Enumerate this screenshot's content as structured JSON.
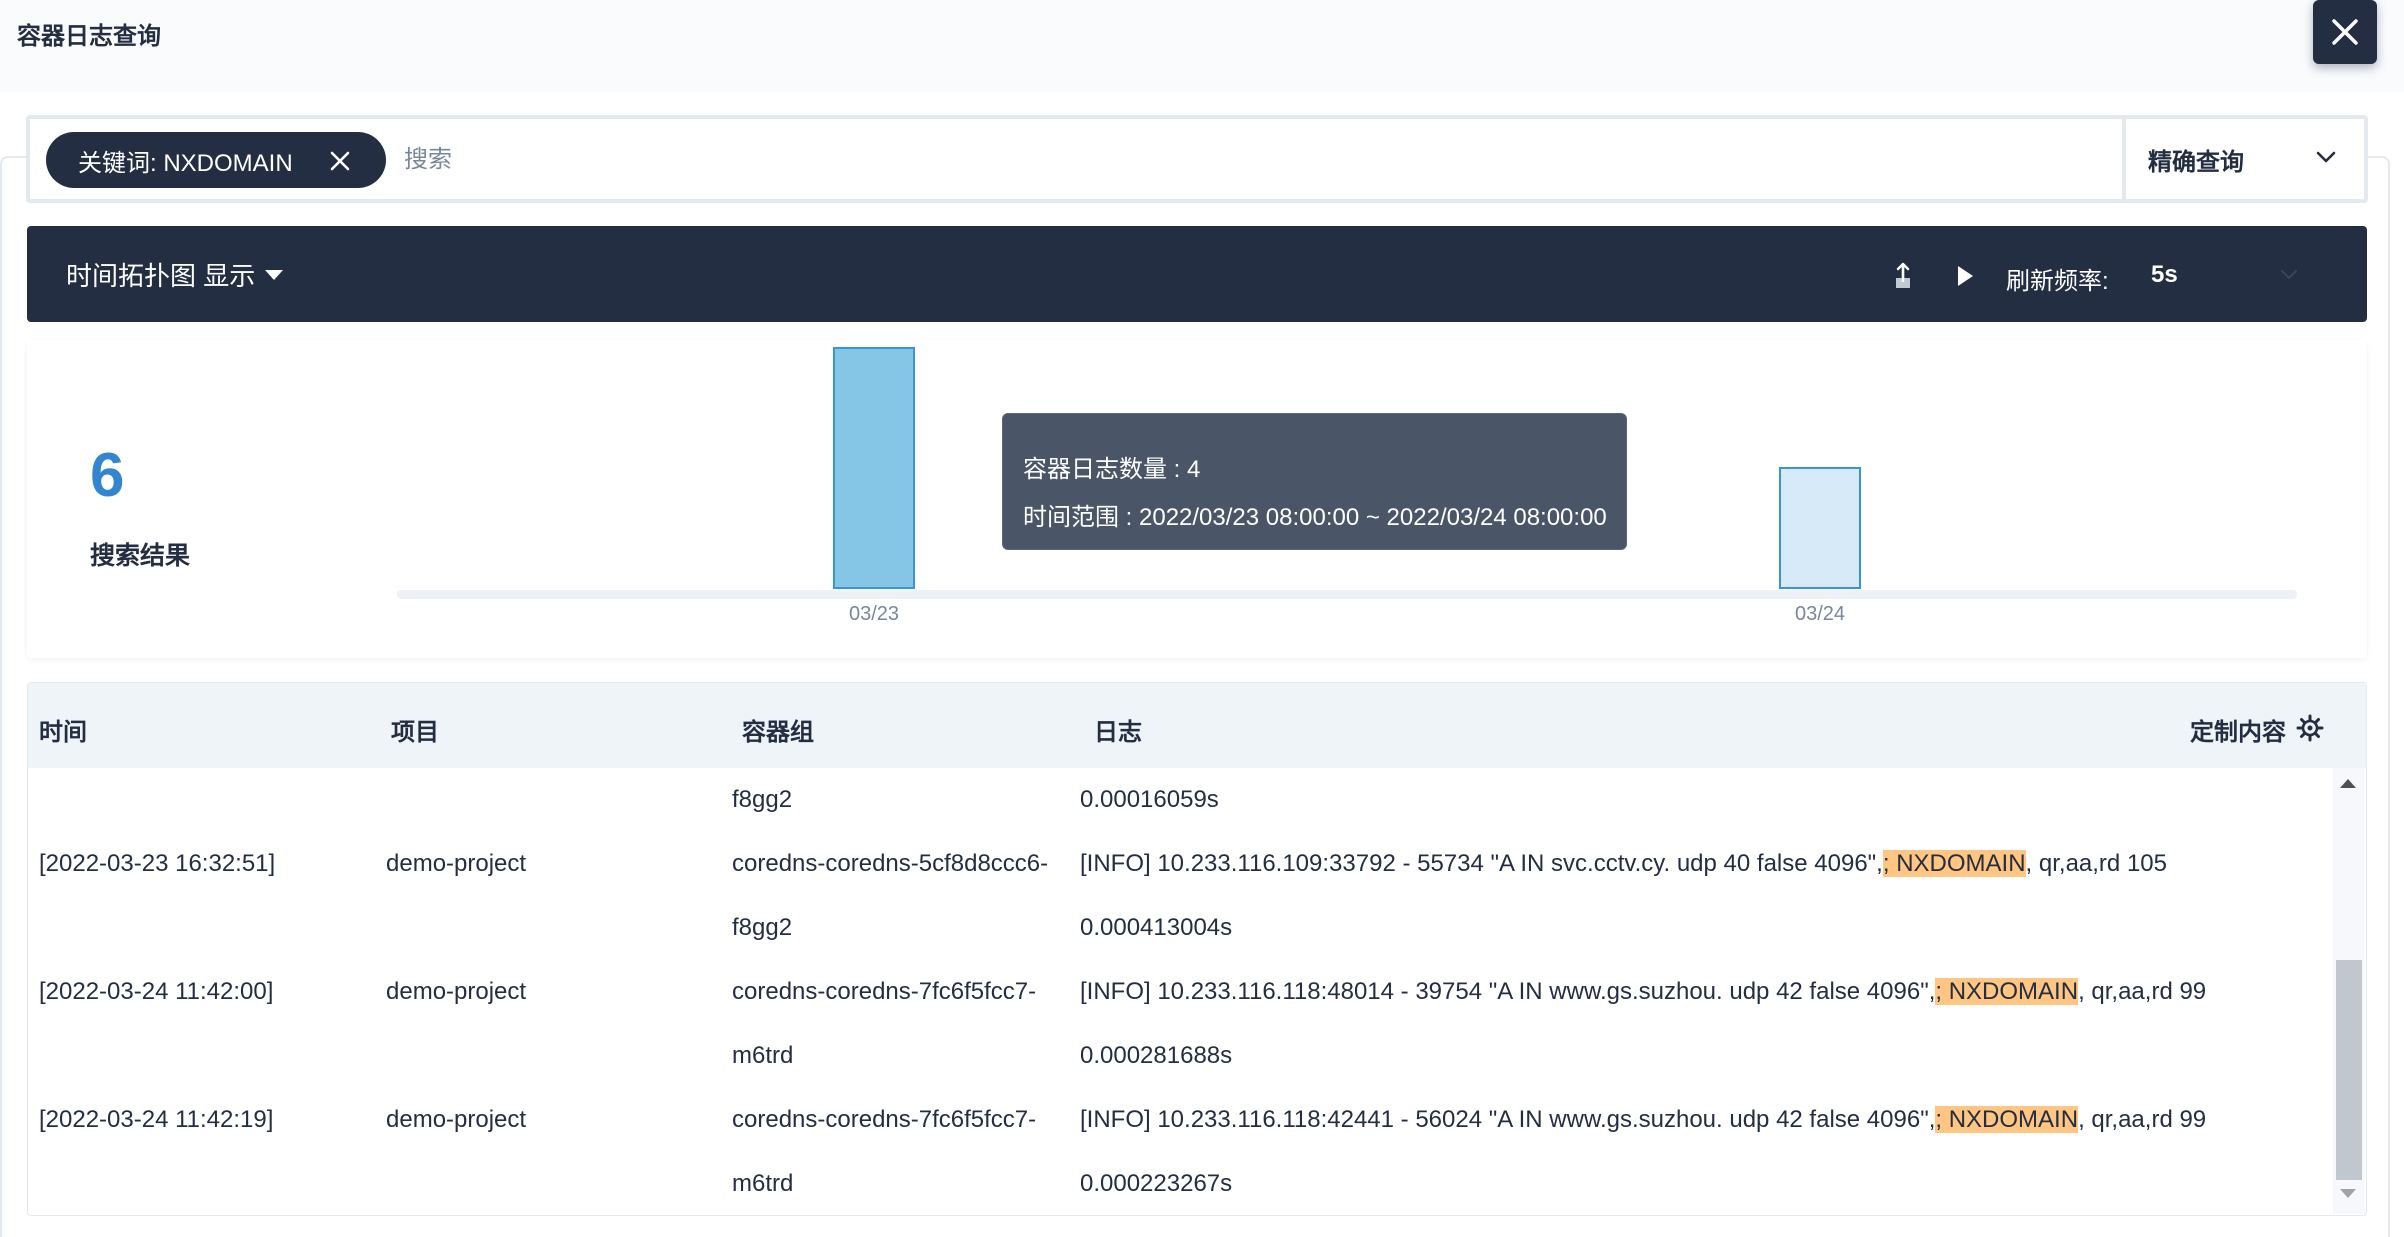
{
  "dialog": {
    "title": "容器日志查询",
    "close_icon": "close-icon"
  },
  "search": {
    "tag_label": "关键词: NXDOMAIN",
    "placeholder": "搜索",
    "mode": "精确查询"
  },
  "toolbar": {
    "toggle_label": "时间拓扑图 显示",
    "refresh_label": "刷新频率:",
    "refresh_value": "5s"
  },
  "summary": {
    "count": "6",
    "label": "搜索结果"
  },
  "chart_data": {
    "type": "bar",
    "categories": [
      "03/23",
      "03/24"
    ],
    "values": [
      4,
      2
    ],
    "title": "",
    "xlabel": "",
    "ylabel": "",
    "colors": [
      "#85c5e5",
      "#d6eaf7"
    ],
    "border_color": "#3a95d5"
  },
  "tooltip": {
    "line1": "容器日志数量 : 4",
    "line2": "时间范围 : 2022/03/23 08:00:00 ~ 2022/03/24 08:00:00"
  },
  "table": {
    "headers": {
      "time": "时间",
      "project": "项目",
      "pod": "容器组",
      "log": "日志",
      "custom": "定制内容"
    },
    "partial_row": {
      "pod": "f8gg2",
      "log": "0.00016059s"
    },
    "rows": [
      {
        "time": "[2022-03-23 16:32:51]",
        "project": "demo-project",
        "pod_line1": "coredns-coredns-5cf8d8ccc6-",
        "pod_line2": "f8gg2",
        "log_pre": "[INFO] 10.233.116.109:33792 - 55734 \"A IN svc.cctv.cy. udp 40 false 4096\",",
        "log_hl": "; NXDOMAIN",
        "log_post": ", qr,aa,rd 105",
        "log_line2": "0.000413004s"
      },
      {
        "time": "[2022-03-24 11:42:00]",
        "project": "demo-project",
        "pod_line1": "coredns-coredns-7fc6f5fcc7-",
        "pod_line2": "m6trd",
        "log_pre": "[INFO] 10.233.116.118:48014 - 39754 \"A IN www.gs.suzhou. udp 42 false 4096\",",
        "log_hl": "; NXDOMAIN",
        "log_post": ", qr,aa,rd 99",
        "log_line2": "0.000281688s"
      },
      {
        "time": "[2022-03-24 11:42:19]",
        "project": "demo-project",
        "pod_line1": "coredns-coredns-7fc6f5fcc7-",
        "pod_line2": "m6trd",
        "log_pre": "[INFO] 10.233.116.118:42441 - 56024 \"A IN www.gs.suzhou. udp 42 false 4096\",",
        "log_hl": "; NXDOMAIN",
        "log_post": ", qr,aa,rd 99",
        "log_line2": "0.000223267s"
      }
    ]
  }
}
